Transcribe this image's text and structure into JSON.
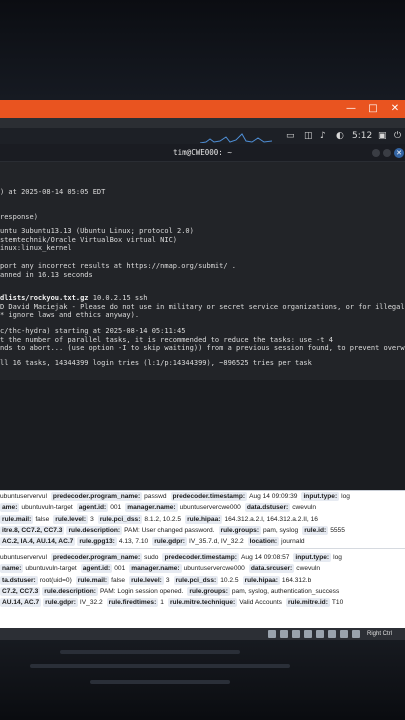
{
  "host_window": {
    "controls": [
      "—",
      "□",
      "✕"
    ]
  },
  "vm_panel": {
    "clock": "5:12"
  },
  "terminal": {
    "title": "tim@CWE000: ~",
    "lines": [
      {
        "text": ") at 2025-08-14 05:05 EDT",
        "bold": false
      },
      {
        "text": "",
        "bold": false
      },
      {
        "text": "response)",
        "bold": false
      },
      {
        "text": "",
        "bold": false
      },
      {
        "text": "untu 3ubuntu13.13 (Ubuntu Linux; protocol 2.0)",
        "bold": false
      },
      {
        "text": "stemtechnik/Oracle VirtualBox virtual NIC)",
        "bold": false
      },
      {
        "text": "inux:linux_kernel",
        "bold": false
      },
      {
        "text": "",
        "bold": false
      },
      {
        "text": "port any incorrect results at https://nmap.org/submit/ .",
        "bold": false
      },
      {
        "text": "anned in 16.13 seconds",
        "bold": false
      },
      {
        "text": "",
        "bold": false
      },
      {
        "text": "dlists/rockyou.txt.gz",
        "bold": true,
        "suffix": " 10.0.2.15 ssh"
      },
      {
        "text": "D David Maciejak - Please do not use in military or secret service organizations, or for illegal p",
        "bold": false
      },
      {
        "text": "* ignore laws and ethics anyway).",
        "bold": false
      },
      {
        "text": "",
        "bold": false
      },
      {
        "text": "c/thc-hydra) starting at 2025-08-14 05:11:45",
        "bold": false
      },
      {
        "text": "t the number of parallel tasks, it is recommended to reduce the tasks: use -t 4",
        "bold": false
      },
      {
        "text": "nds to abort... (use option -I to skip waiting)) from a previous session found, to prevent overwr",
        "bold": false
      },
      {
        "text": "",
        "bold": false
      },
      {
        "text": "ll 16 tasks, 14344399 login tries (l:1/p:14344399), ~896525 tries per task",
        "bold": false
      }
    ]
  },
  "log_entries": [
    {
      "rows": [
        [
          [
            "",
            "ubuntuservervul"
          ],
          [
            "predecoder.program_name:",
            "passwd"
          ],
          [
            "predecoder.timestamp:",
            "Aug 14 09:09:39"
          ],
          [
            "input.type:",
            "log"
          ]
        ],
        [
          [
            "ame:",
            "ubuntuvuln-target"
          ],
          [
            "agent.id:",
            "001"
          ],
          [
            "manager.name:",
            "ubuntuservercwe000"
          ],
          [
            "data.dstuser:",
            "cwevuln"
          ]
        ],
        [
          [
            "rule.mail:",
            "false"
          ],
          [
            "rule.level:",
            "3"
          ],
          [
            "rule.pci_dss:",
            "8.1.2, 10.2.5"
          ],
          [
            "rule.hipaa:",
            "164.312.a.2.I, 164.312.a.2.II, 16"
          ]
        ],
        [
          [
            "itre.8, CC7.2, CC7.3",
            ""
          ],
          [
            "rule.description:",
            "PAM: User changed password."
          ],
          [
            "rule.groups:",
            "pam, syslog"
          ],
          [
            "rule.id:",
            "5555"
          ]
        ],
        [
          [
            "AC.2, IA.4, AU.14, AC.7",
            ""
          ],
          [
            "rule.gpg13:",
            "4.13, 7.10"
          ],
          [
            "rule.gdpr:",
            "IV_35.7.d, IV_32.2"
          ],
          [
            "location:",
            "journald"
          ]
        ]
      ]
    },
    {
      "rows": [
        [
          [
            "",
            "ubuntuservervul"
          ],
          [
            "predecoder.program_name:",
            "sudo"
          ],
          [
            "predecoder.timestamp:",
            "Aug 14 09:08:57"
          ],
          [
            "input.type:",
            "log"
          ]
        ],
        [
          [
            "name:",
            "ubuntuvuln-target"
          ],
          [
            "agent.id:",
            "001"
          ],
          [
            "manager.name:",
            "ubuntuservercwe000"
          ],
          [
            "data.srcuser:",
            "cwevuln"
          ]
        ],
        [
          [
            "ta.dstuser:",
            "root(uid=0)"
          ],
          [
            "rule.mail:",
            "false"
          ],
          [
            "rule.level:",
            "3"
          ],
          [
            "rule.pci_dss:",
            "10.2.5"
          ],
          [
            "rule.hipaa:",
            "164.312.b"
          ]
        ],
        [
          [
            "C7.2, CC7.3",
            ""
          ],
          [
            "rule.description:",
            "PAM: Login session opened."
          ],
          [
            "rule.groups:",
            "pam, syslog, authentication_success"
          ]
        ],
        [
          [
            "AU.14, AC.7",
            ""
          ],
          [
            "rule.gdpr:",
            "IV_32.2"
          ],
          [
            "rule.firedtimes:",
            "1"
          ],
          [
            "rule.mitre.technique:",
            "Valid Accounts"
          ],
          [
            "rule.mitre.id:",
            "T10"
          ]
        ]
      ]
    }
  ],
  "vm_status": {
    "host_key": "Right Ctrl"
  }
}
